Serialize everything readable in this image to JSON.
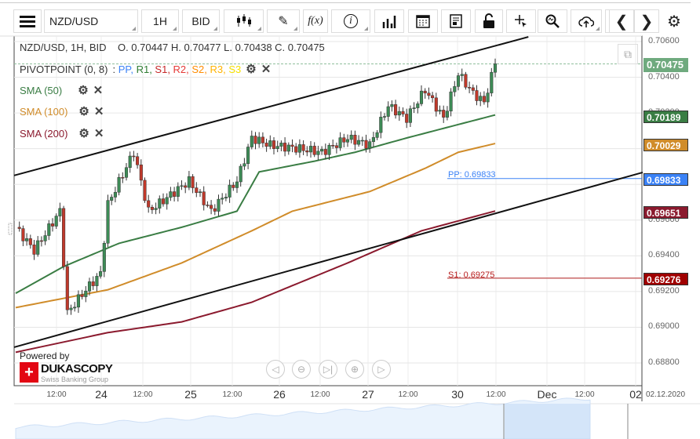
{
  "toolbar": {
    "menu": "menu-icon",
    "symbol": "NZD/USD",
    "timeframe": "1H",
    "side": "BID",
    "fx": "f(x)",
    "info": "i"
  },
  "legend": {
    "ohlc": "NZD/USD, 1H, BID    O. 0.70447 H. 0.70477 L. 0.70438 C. 0.70475",
    "pivot_name": "PIVOTPOINT (0, 8)",
    "pivot_sep": ":",
    "pivot_items": [
      {
        "t": "PP",
        "c": "#3b82f6"
      },
      {
        "t": "R1",
        "c": "#2e7d32"
      },
      {
        "t": "S1",
        "c": "#c62828"
      },
      {
        "t": "R2",
        "c": "#e53935"
      },
      {
        "t": "S2",
        "c": "#ff8c00"
      },
      {
        "t": "R3",
        "c": "#ffb300"
      },
      {
        "t": "S3",
        "c": "#f5e000"
      }
    ],
    "sma50": "SMA (50)",
    "sma100": "SMA (100)",
    "sma200": "SMA (200)"
  },
  "colors": {
    "up": "#3d8b56",
    "down": "#c0392b",
    "sma50": "#3a7d44",
    "sma100": "#d08c2a",
    "sma200": "#8b1a2e",
    "pp": "#3b82f6",
    "s1": "#b71c1c",
    "current": "#6faa7e"
  },
  "price_labels": {
    "current": "0.70475",
    "sma50": "0.70189",
    "sma100": "0.70029",
    "pp": "0.69833",
    "sma200": "0.69651",
    "s1": "0.69276"
  },
  "pivots": {
    "pp": "PP: 0.69833",
    "s1": "S1: 0.69275"
  },
  "axis": {
    "prices": [
      "0.70600",
      "0.70400",
      "0.70200",
      "0.70000",
      "0.69800",
      "0.69600",
      "0.69400",
      "0.69200",
      "0.69000",
      "0.68800"
    ],
    "times": [
      "12:00",
      "24",
      "12:00",
      "25",
      "12:00",
      "26",
      "12:00",
      "27",
      "12:00",
      "30",
      "12:00",
      "Dec",
      "12:00",
      "02"
    ],
    "date": "02.12.2020"
  },
  "branding": {
    "powered": "Powered by",
    "name": "DUKASCOPY",
    "sub": "Swiss Banking Group"
  },
  "chart_data": {
    "type": "candlestick",
    "symbol": "NZD/USD",
    "interval": "1H",
    "ylim": [
      0.6875,
      0.7063
    ],
    "close_path": [
      [
        0,
        0.6956
      ],
      [
        5,
        0.6943
      ],
      [
        12,
        0.6965
      ],
      [
        14,
        0.6908
      ],
      [
        19,
        0.6921
      ],
      [
        23,
        0.693
      ],
      [
        25,
        0.6969
      ],
      [
        32,
        0.6998
      ],
      [
        36,
        0.6965
      ],
      [
        40,
        0.6971
      ],
      [
        47,
        0.6982
      ],
      [
        53,
        0.6965
      ],
      [
        60,
        0.6982
      ],
      [
        64,
        0.7006
      ],
      [
        69,
        0.7002
      ],
      [
        77,
        0.7
      ],
      [
        83,
        0.6998
      ],
      [
        90,
        0.7006
      ],
      [
        96,
        0.7002
      ],
      [
        101,
        0.7024
      ],
      [
        106,
        0.7017
      ],
      [
        111,
        0.7033
      ],
      [
        116,
        0.7017
      ],
      [
        120,
        0.7042
      ],
      [
        124,
        0.7031
      ],
      [
        127,
        0.7026
      ],
      [
        130,
        0.70475
      ]
    ],
    "sma50": [
      [
        0,
        0.6919
      ],
      [
        13,
        0.6934
      ],
      [
        28,
        0.6947
      ],
      [
        45,
        0.6956
      ],
      [
        60,
        0.6965
      ],
      [
        66,
        0.6987
      ],
      [
        81,
        0.6993
      ],
      [
        92,
        0.6998
      ],
      [
        106,
        0.7006
      ],
      [
        119,
        0.7013
      ],
      [
        130,
        0.70189
      ]
    ],
    "sma100": [
      [
        0,
        0.6911
      ],
      [
        25,
        0.6921
      ],
      [
        45,
        0.6936
      ],
      [
        64,
        0.6954
      ],
      [
        75,
        0.6965
      ],
      [
        96,
        0.6976
      ],
      [
        111,
        0.6989
      ],
      [
        120,
        0.6998
      ],
      [
        130,
        0.70029
      ]
    ],
    "sma200": [
      [
        0,
        0.6886
      ],
      [
        25,
        0.6897
      ],
      [
        45,
        0.6903
      ],
      [
        64,
        0.6914
      ],
      [
        90,
        0.6936
      ],
      [
        110,
        0.6954
      ],
      [
        130,
        0.69651
      ]
    ],
    "trend_upper": [
      [
        0,
        0.6985
      ],
      [
        139,
        0.70626
      ]
    ],
    "trend_lower": [
      [
        0,
        0.68888
      ],
      [
        170,
        0.69867
      ]
    ],
    "pivot_pp": 0.69833,
    "pivot_s1": 0.69275,
    "current": 0.70475
  }
}
